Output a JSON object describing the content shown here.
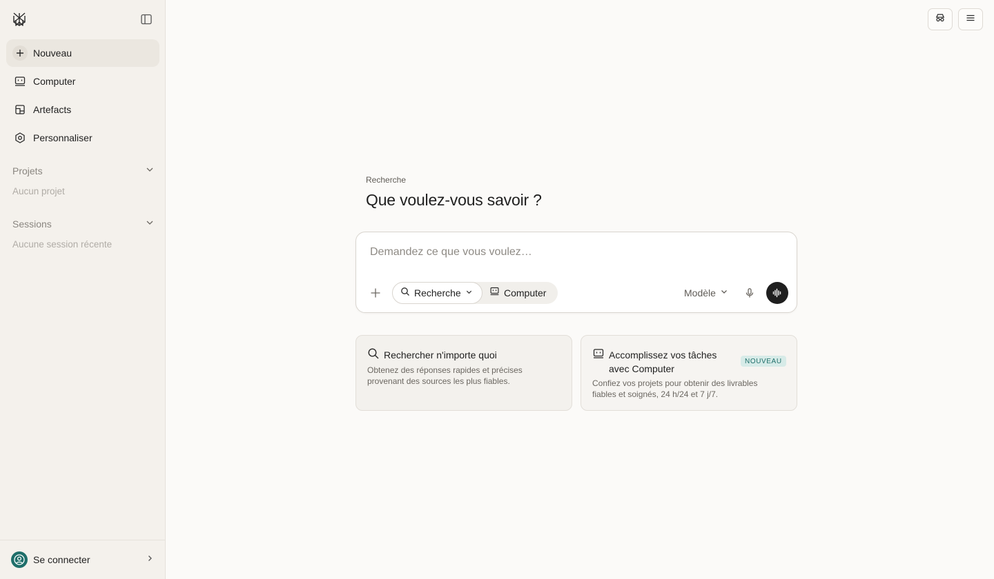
{
  "sidebar": {
    "items": [
      {
        "label": "Nouveau",
        "icon": "plus-icon"
      },
      {
        "label": "Computer",
        "icon": "computer-icon"
      },
      {
        "label": "Artefacts",
        "icon": "artifacts-icon"
      },
      {
        "label": "Personnaliser",
        "icon": "hexagon-icon"
      }
    ],
    "projects": {
      "title": "Projets",
      "empty": "Aucun projet"
    },
    "sessions": {
      "title": "Sessions",
      "empty": "Aucune session récente"
    },
    "footer": {
      "label": "Se connecter"
    }
  },
  "main": {
    "eyebrow": "Recherche",
    "headline": "Que voulez-vous savoir ?",
    "composer": {
      "placeholder": "Demandez ce que vous voulez…",
      "mode_search": "Recherche",
      "mode_computer": "Computer",
      "model": "Modèle"
    },
    "cards": [
      {
        "title": "Rechercher n'importe quoi",
        "description": "Obtenez des réponses rapides et précises provenant des sources les plus fiables."
      },
      {
        "title": "Accomplissez vos tâches avec Computer",
        "badge": "NOUVEAU",
        "description": "Confiez vos projets pour obtenir des livrables fiables et soignés, 24 h/24 et 7 j/7."
      }
    ]
  },
  "colors": {
    "accent": "#1f6f6a",
    "badge_bg": "#d7ebe8",
    "sidebar_bg": "#f4f1ec",
    "page_bg": "#fbfaf8"
  }
}
